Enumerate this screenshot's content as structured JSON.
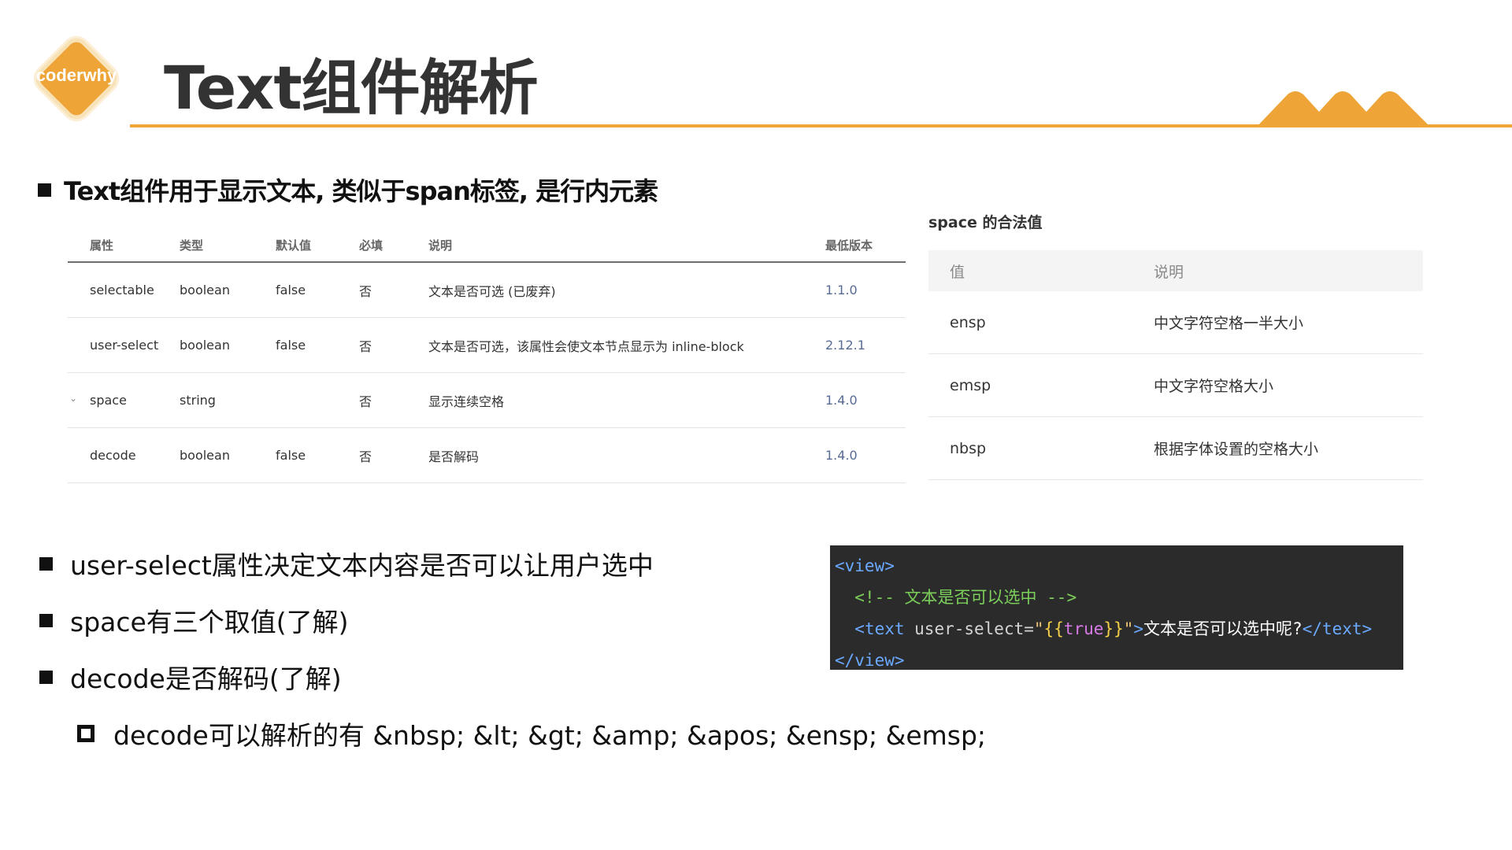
{
  "header": {
    "logo_text": "coderwhy",
    "title": "Text组件解析"
  },
  "headline": "Text组件用于显示文本, 类似于span标签, 是行内元素",
  "attr_table": {
    "headers": [
      "属性",
      "类型",
      "默认值",
      "必填",
      "说明",
      "最低版本"
    ],
    "rows": [
      {
        "name": "selectable",
        "type": "boolean",
        "default": "false",
        "required": "否",
        "desc": "文本是否可选 (已废弃)",
        "version": "1.1.0"
      },
      {
        "name": "user-select",
        "type": "boolean",
        "default": "false",
        "required": "否",
        "desc": "文本是否可选，该属性会使文本节点显示为 inline-block",
        "version": "2.12.1"
      },
      {
        "name": "space",
        "type": "string",
        "default": "",
        "required": "否",
        "desc": "显示连续空格",
        "version": "1.4.0"
      },
      {
        "name": "decode",
        "type": "boolean",
        "default": "false",
        "required": "否",
        "desc": "是否解码",
        "version": "1.4.0"
      }
    ]
  },
  "space_table": {
    "title": "space 的合法值",
    "headers": [
      "值",
      "说明"
    ],
    "rows": [
      {
        "value": "ensp",
        "desc": "中文字符空格一半大小"
      },
      {
        "value": "emsp",
        "desc": "中文字符空格大小"
      },
      {
        "value": "nbsp",
        "desc": "根据字体设置的空格大小"
      }
    ]
  },
  "bullets": [
    "user-select属性决定文本内容是否可以让用户选中",
    "space有三个取值(了解)",
    "decode是否解码(了解)"
  ],
  "sub_bullet": "decode可以解析的有 &nbsp; &lt; &gt; &amp; &apos; &ensp; &emsp;",
  "code": {
    "line1_open": "<view>",
    "line2_comment": "<!-- 文本是否可以选中 -->",
    "line3_tag_open": "<text",
    "line3_attr": " user-select",
    "line3_eq": "=",
    "line3_q1": "\"",
    "line3_brace_open": "{{",
    "line3_kw": "true",
    "line3_brace_close": "}}",
    "line3_q2": "\"",
    "line3_gt": ">",
    "line3_text": "文本是否可以选中呢?",
    "line3_tag_close": "</text>",
    "line4_close": "</view>"
  },
  "colors": {
    "accent": "#eea437",
    "version_link": "#576b95",
    "code_bg": "#2b2b2b"
  }
}
